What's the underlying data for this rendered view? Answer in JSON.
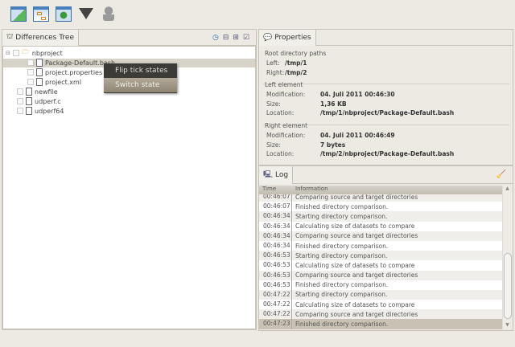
{
  "toolbar": {
    "buttons": [
      {
        "icon": "compare-window-icon"
      },
      {
        "icon": "tree-window-icon"
      },
      {
        "icon": "refresh-window-icon"
      },
      {
        "icon": "filter-funnel-icon"
      },
      {
        "icon": "user-icon"
      }
    ]
  },
  "tree_panel": {
    "title": "Differences Tree",
    "actions": [
      "navigate-icon",
      "collapse-icon",
      "expand-icon",
      "check-icon"
    ],
    "nodes": [
      {
        "label": "nbproject"
      },
      {
        "label": "Package-Default.bash"
      },
      {
        "label": "project.properties"
      },
      {
        "label": "project.xml"
      },
      {
        "label": "newfile"
      },
      {
        "label": "udperf.c"
      },
      {
        "label": "udperf64"
      }
    ]
  },
  "context_menu": {
    "items": [
      "Flip tick states",
      "Switch state"
    ]
  },
  "properties": {
    "title": "Properties",
    "root_heading": "Root directory paths",
    "left_label": "Left:",
    "left_value": "/tmp/1",
    "right_label": "Right:",
    "right_value": "/tmp/2",
    "left_element": {
      "heading": "Left element",
      "mod_label": "Modification:",
      "mod": "04. Juli 2011 00:46:30",
      "size_label": "Size:",
      "size": "1,36 KB",
      "loc_label": "Location:",
      "loc": "/tmp/1/nbproject/Package-Default.bash"
    },
    "right_element": {
      "heading": "Right element",
      "mod_label": "Modification:",
      "mod": "04. Juli 2011 00:46:49",
      "size_label": "Size:",
      "size": "7 bytes",
      "loc_label": "Location:",
      "loc": "/tmp/2/nbproject/Package-Default.bash"
    }
  },
  "log": {
    "title": "Log",
    "col_time": "Time",
    "col_info": "Information",
    "rows": [
      [
        "00:46:07",
        "Comparing source and target directories"
      ],
      [
        "00:46:07",
        "Finished directory comparison."
      ],
      [
        "00:46:34",
        "Starting directory comparison."
      ],
      [
        "00:46:34",
        "Calculating size of datasets to compare"
      ],
      [
        "00:46:34",
        "Comparing source and target directories"
      ],
      [
        "00:46:34",
        "Finished directory comparison."
      ],
      [
        "00:46:53",
        "Starting directory comparison."
      ],
      [
        "00:46:53",
        "Calculating size of datasets to compare"
      ],
      [
        "00:46:53",
        "Comparing source and target directories"
      ],
      [
        "00:46:53",
        "Finished directory comparison."
      ],
      [
        "00:47:22",
        "Starting directory comparison."
      ],
      [
        "00:47:22",
        "Calculating size of datasets to compare"
      ],
      [
        "00:47:22",
        "Comparing source and target directories"
      ],
      [
        "00:47:23",
        "Finished directory comparison."
      ]
    ]
  }
}
